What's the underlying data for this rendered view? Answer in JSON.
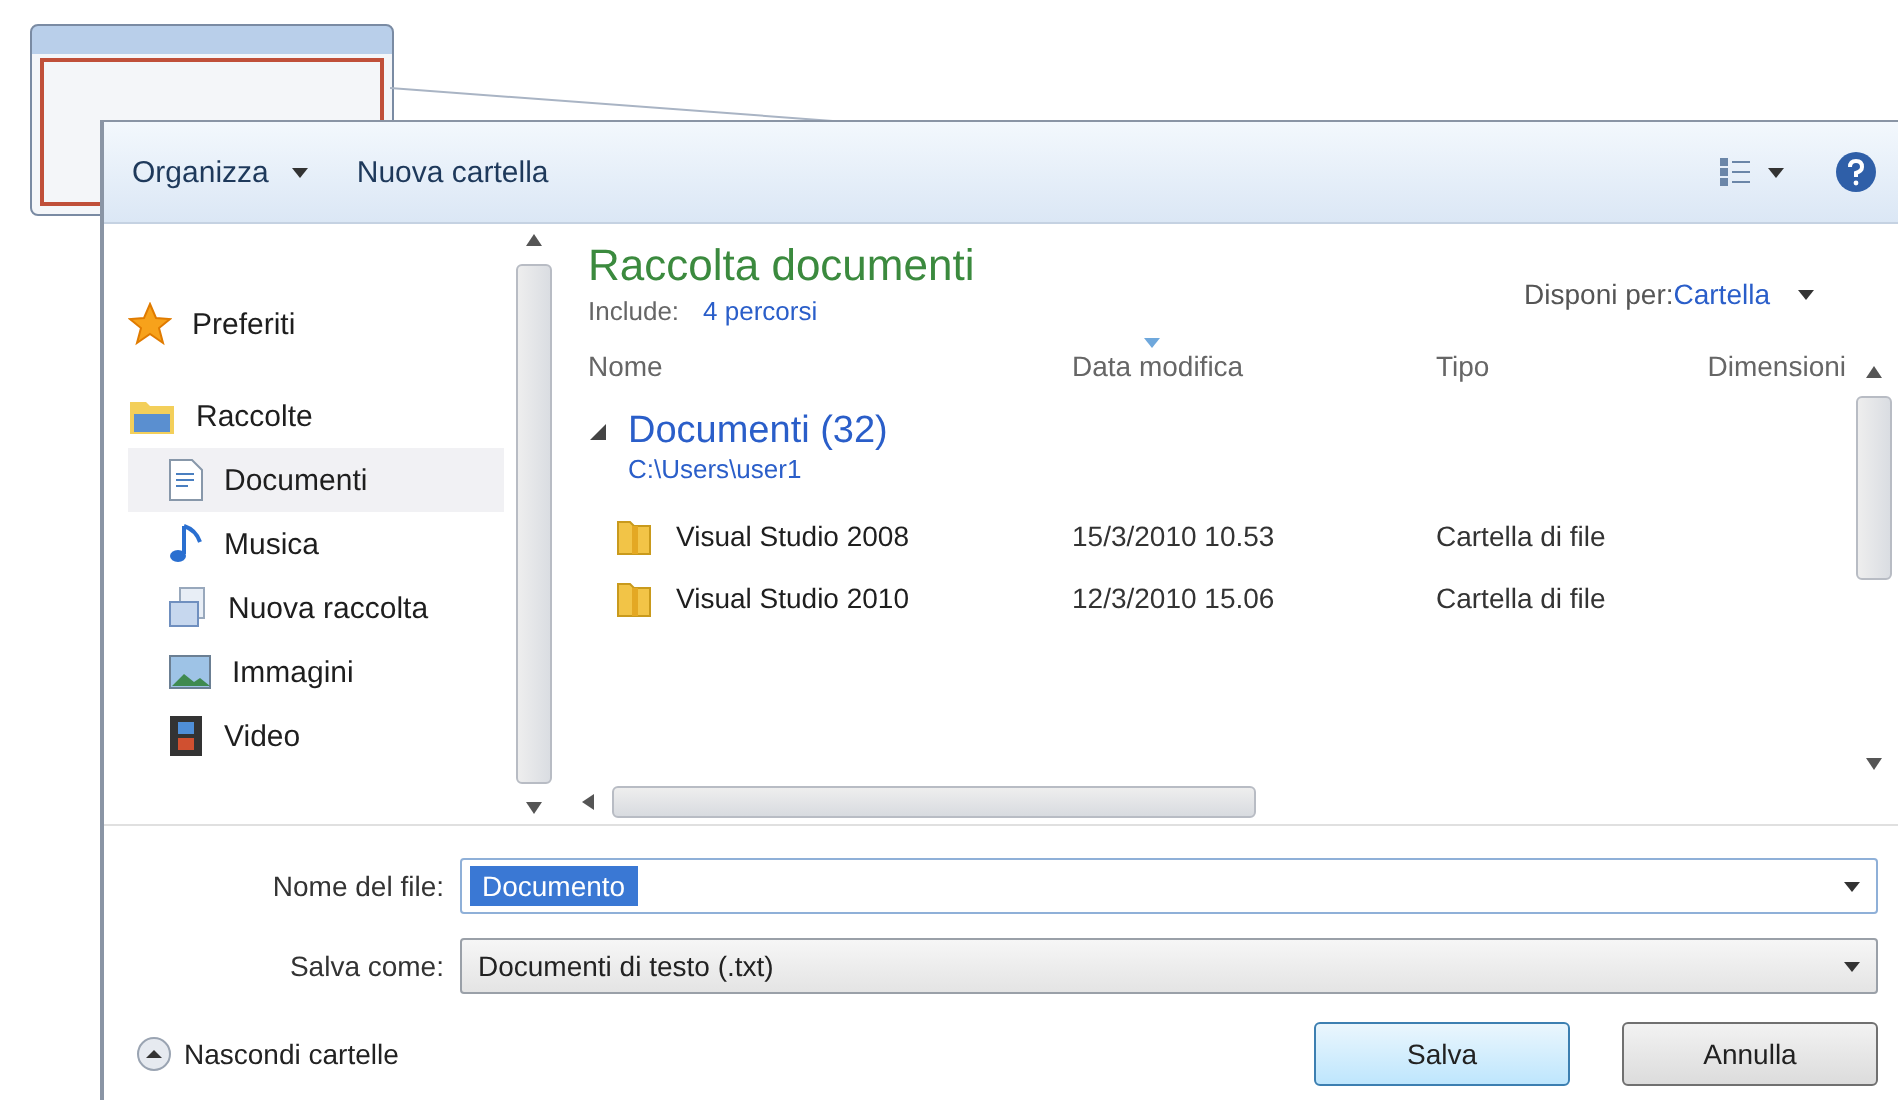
{
  "toolbar": {
    "organize": "Organizza",
    "new_folder": "Nuova cartella"
  },
  "nav": [
    {
      "label": "Preferiti",
      "kind": "star",
      "selected": false
    },
    {
      "label": "Raccolte",
      "kind": "library",
      "selected": false,
      "children": [
        {
          "label": "Documenti",
          "kind": "document",
          "selected": true
        },
        {
          "label": "Musica",
          "kind": "music",
          "selected": false
        },
        {
          "label": "Nuova raccolta",
          "kind": "newlib",
          "selected": false
        },
        {
          "label": "Immagini",
          "kind": "picture",
          "selected": false
        },
        {
          "label": "Video",
          "kind": "video",
          "selected": false
        }
      ]
    }
  ],
  "library": {
    "title": "Raccolta documenti",
    "include_label": "Include:",
    "include_link": "4 percorsi",
    "arrange_label": "Disponi per:",
    "arrange_value": "Cartella"
  },
  "columns": [
    {
      "label": "Nome",
      "sorted": false
    },
    {
      "label": "Data modifica",
      "sorted": true
    },
    {
      "label": "Tipo",
      "sorted": false
    },
    {
      "label": "Dimensioni",
      "sorted": false
    }
  ],
  "group": {
    "title": "Documenti (32)",
    "path": "C:\\Users\\user1",
    "expanded": true
  },
  "rows": [
    {
      "name": "Visual Studio 2008",
      "date": "15/3/2010 10.53",
      "type": "Cartella di file"
    },
    {
      "name": "Visual Studio 2010",
      "date": "12/3/2010 15.06",
      "type": "Cartella di file"
    }
  ],
  "file_name": {
    "label": "Nome del file:",
    "value": "Documento"
  },
  "save_as": {
    "label": "Salva come:",
    "value": "Documenti di testo (.txt)"
  },
  "hide_folders": "Nascondi cartelle",
  "buttons": [
    {
      "label": "Salva",
      "default": true
    },
    {
      "label": "Annulla",
      "default": false
    }
  ]
}
